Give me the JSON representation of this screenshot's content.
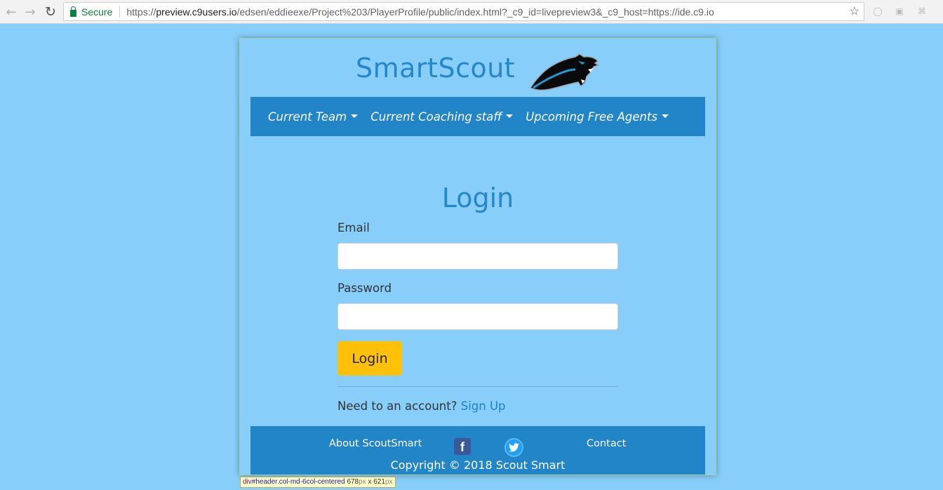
{
  "browser": {
    "secure_label": "Secure",
    "url_prefix": "https://",
    "url_domain": "preview.c9users.io",
    "url_rest": "/edsen/eddieexe/Project%203/PlayerProfile/public/index.html?_c9_id=livepreview3&_c9_host=https://ide.c9.io"
  },
  "header": {
    "brand": "SmartScout"
  },
  "nav": {
    "items": [
      {
        "label": "Current Team"
      },
      {
        "label": "Current Coaching staff"
      },
      {
        "label": "Upcoming Free Agents"
      }
    ]
  },
  "login": {
    "title": "Login",
    "email_label": "Email",
    "email_value": "",
    "password_label": "Password",
    "password_value": "",
    "submit_label": "Login",
    "signup_prompt": "Need to an account?",
    "signup_link": "Sign Up"
  },
  "footer": {
    "about": "About ScoutSmart",
    "contact": "Contact",
    "copyright": "Copyright © 2018 Scout Smart"
  },
  "devtools_tip": {
    "tag": "div",
    "selector": "#header.col-md-6col-centered",
    "width": "678",
    "unit1": "px",
    "x": " x ",
    "height": "621",
    "unit2": "px"
  },
  "colors": {
    "page_bg": "#87cefa",
    "brand_blue": "#2285c8",
    "button_yellow": "#ffc107",
    "link_blue": "#1e7fd8"
  }
}
